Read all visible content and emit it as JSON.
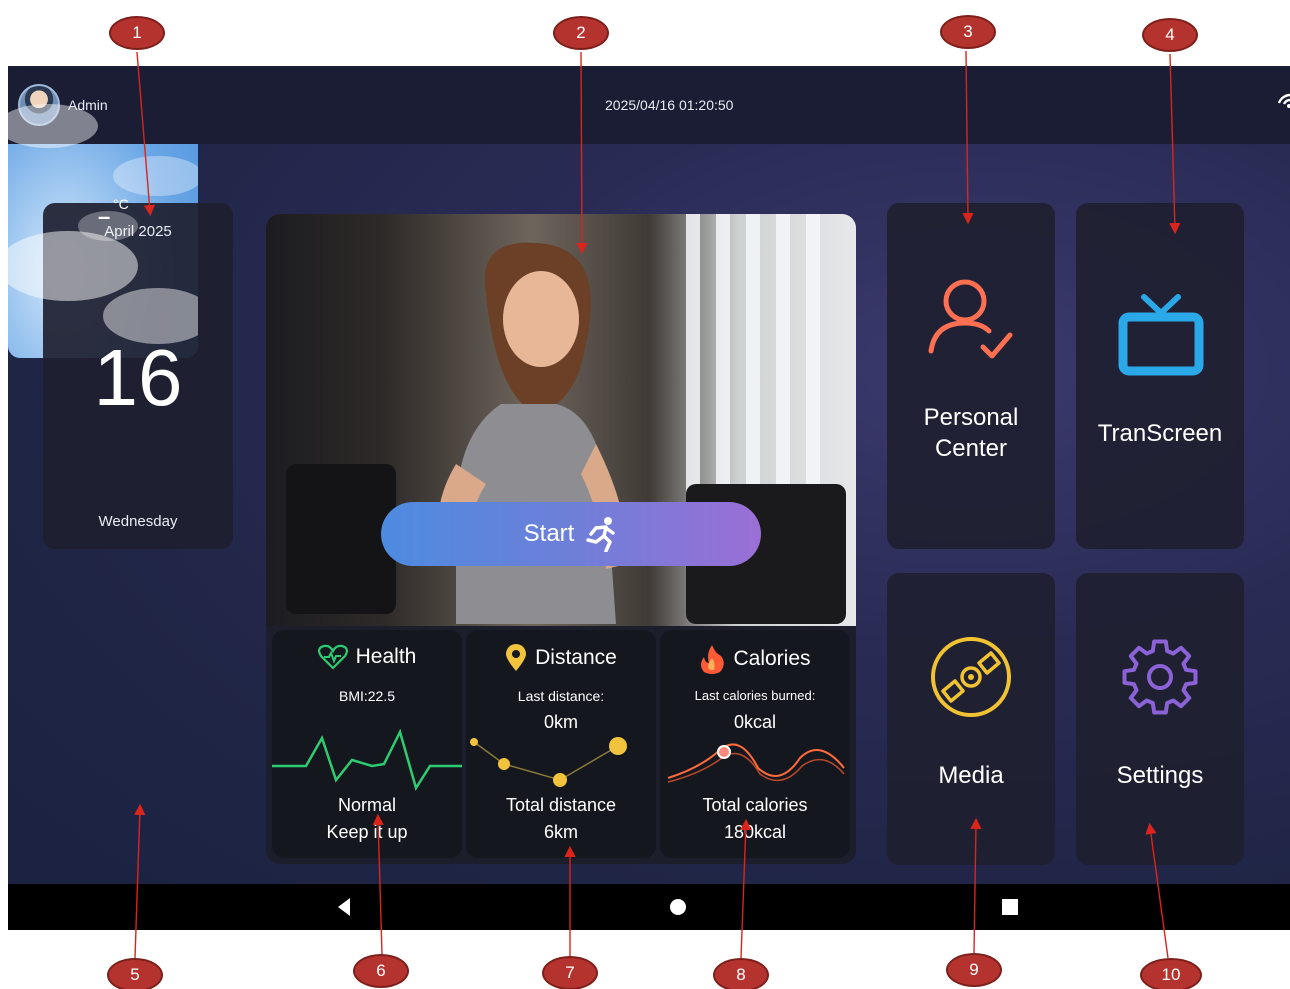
{
  "status_bar": {
    "user": "Admin",
    "datetime": "2025/04/16 01:20:50"
  },
  "calendar": {
    "month": "April 2025",
    "day": "16",
    "weekday": "Wednesday"
  },
  "weather": {
    "unit": "°C",
    "temperature": "–"
  },
  "hero": {
    "start_label": "Start"
  },
  "stats": {
    "health": {
      "title": "Health",
      "bmi": "BMI:22.5",
      "status": "Normal",
      "message": "Keep it up"
    },
    "distance": {
      "title": "Distance",
      "last_label": "Last distance:",
      "last_value": "0km",
      "total_label": "Total distance",
      "total_value": "6km"
    },
    "calories": {
      "title": "Calories",
      "last_label": "Last calories burned:",
      "last_value": "0kcal",
      "total_label": "Total calories",
      "total_value": "180kcal"
    }
  },
  "tiles": {
    "personal_center": {
      "line1": "Personal",
      "line2": "Center"
    },
    "transcreen": {
      "label": "TranScreen"
    },
    "media": {
      "label": "Media"
    },
    "settings": {
      "label": "Settings"
    }
  },
  "callouts": [
    "1",
    "2",
    "3",
    "4",
    "5",
    "6",
    "7",
    "8",
    "9",
    "10"
  ],
  "colors": {
    "callout": "#b5332e",
    "health_accent": "#2ecc71",
    "distance_accent": "#f2c33d",
    "calories_accent": "#ff6b3d",
    "personal_icon": "#ff6f52",
    "transcreen_icon": "#2aa8e8",
    "media_icon": "#f1c232",
    "settings_icon": "#8b62d8",
    "start_gradient": [
      "#4d8be0",
      "#9a6fd6"
    ]
  },
  "icons": {
    "health": "heart-pulse-icon",
    "distance": "location-pin-icon",
    "calories": "flame-icon",
    "personal_center": "user-check-icon",
    "transcreen": "tv-icon",
    "media": "disc-icon",
    "settings": "gear-icon",
    "start": "running-person-icon",
    "wifi": "wifi-icon",
    "nav_back": "back-triangle-icon",
    "nav_home": "home-circle-icon",
    "nav_recent": "recent-square-icon"
  }
}
